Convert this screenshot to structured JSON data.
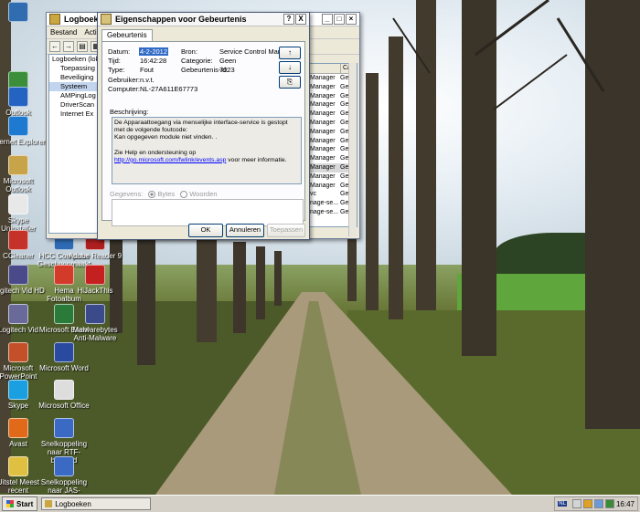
{
  "desktop": {
    "icons": [
      {
        "label": "",
        "color": "#2f6cb0"
      },
      {
        "label": "",
        "color": "#3b8f3b"
      },
      {
        "label": "Outlook",
        "color": "#2463c2"
      },
      {
        "label": "Internet Explorer",
        "color": "#1e7ad0"
      },
      {
        "label": "Microsoft Outlook",
        "color": "#c7a34a"
      },
      {
        "label": "Skype Uninstaller",
        "color": "#e8e8e8"
      },
      {
        "label": "CCleaner",
        "color": "#c4322a"
      },
      {
        "label": "HCC Computer Geschoonmaakt",
        "color": "#2e6bb4"
      },
      {
        "label": "Adobe Reader 9",
        "color": "#b01f1f"
      },
      {
        "label": "Logitech Vid HD",
        "color": "#4a4a8a"
      },
      {
        "label": "Hema Fotoalbum",
        "color": "#d23a2a"
      },
      {
        "label": "HiJackThis",
        "color": "#c42020"
      },
      {
        "label": "Logitech Vid",
        "color": "#6a6a9a"
      },
      {
        "label": "Microsoft Excel",
        "color": "#2a7a3a"
      },
      {
        "label": "Malwarebytes Anti-Malware",
        "color": "#3a4a8a"
      },
      {
        "label": "Microsoft PowerPoint",
        "color": "#c4502a"
      },
      {
        "label": "Microsoft Word",
        "color": "#2a4aa0"
      },
      {
        "label": "Skype",
        "color": "#1aa0e0"
      },
      {
        "label": "Microsoft Office",
        "color": "#dddddd"
      },
      {
        "label": "Avast",
        "color": "#e06a1a"
      },
      {
        "label": "Snelkoppeling naar RTF-bestand",
        "color": "#3a6ac4"
      },
      {
        "label": "Snelkoppeling naar JAS-bestand",
        "color": "#3a6ac4"
      },
      {
        "label": "Uitstel Meest recent",
        "color": "#e0c040"
      }
    ]
  },
  "logwindow": {
    "title": "Logboeken",
    "menu": [
      "Bestand",
      "Actie"
    ],
    "tree": [
      {
        "label": "Logboeken (lok",
        "selected": false
      },
      {
        "label": "Toepassing",
        "selected": false
      },
      {
        "label": "Beveiliging",
        "selected": false
      },
      {
        "label": "Systeem",
        "selected": true
      },
      {
        "label": "AMPingLog",
        "selected": false
      },
      {
        "label": "DriverScan",
        "selected": false
      },
      {
        "label": "Internet Ex",
        "selected": false
      }
    ],
    "list_header": [
      "",
      "Ca"
    ],
    "list_rows": [
      {
        "src": "Manager",
        "cat": "Ge",
        "hl": false
      },
      {
        "src": "Manager",
        "cat": "Ge",
        "hl": false
      },
      {
        "src": "Manager",
        "cat": "Ge",
        "hl": false
      },
      {
        "src": "Manager",
        "cat": "Ge",
        "hl": false
      },
      {
        "src": "Manager",
        "cat": "Ge",
        "hl": false
      },
      {
        "src": "Manager",
        "cat": "Ge",
        "hl": false
      },
      {
        "src": "Manager",
        "cat": "Ge",
        "hl": false
      },
      {
        "src": "Manager",
        "cat": "Ge",
        "hl": false
      },
      {
        "src": "Manager",
        "cat": "Ge",
        "hl": false
      },
      {
        "src": "Manager",
        "cat": "Ge",
        "hl": false
      },
      {
        "src": "Manager",
        "cat": "Ge",
        "hl": true
      },
      {
        "src": "Manager",
        "cat": "Ge",
        "hl": false
      },
      {
        "src": "Manager",
        "cat": "Ge",
        "hl": false
      },
      {
        "src": "vc",
        "cat": "Ge",
        "hl": false
      },
      {
        "src": "nage-se...",
        "cat": "Ge",
        "hl": false
      },
      {
        "src": "nage-se...",
        "cat": "Ge",
        "hl": false
      }
    ]
  },
  "dialog": {
    "title": "Eigenschappen voor Gebeurtenis",
    "help_btn": "?",
    "close_btn": "X",
    "tab": "Gebeurtenis",
    "fields": {
      "datum_label": "Datum:",
      "datum": "4-2-2012",
      "tijd_label": "Tijd:",
      "tijd": "16:42:28",
      "type_label": "Type:",
      "type": "Fout",
      "gebruiker_label": "Gebruiker:",
      "gebruiker": "n.v.t.",
      "computer_label": "Computer:",
      "computer": "NL-27A611E67773",
      "bron_label": "Bron:",
      "bron": "Service Control Manager",
      "categorie_label": "Categorie:",
      "categorie": "Geen",
      "id_label": "Gebeurtenis-id:",
      "id": "7023"
    },
    "beschrijving_label": "Beschrijving:",
    "description_line1": "De Apparaattoegang via menselijke interface-service is gestopt met de volgende foutcode:",
    "description_line2": "Kan opgegeven module niet vinden. .",
    "help_prefix": "Zie Help en ondersteuning op ",
    "help_link": "http://go.microsoft.com/fwlink/events.asp",
    "help_suffix": " voor meer informatie.",
    "gegevens_label": "Gegevens:",
    "bytes_label": "Bytes",
    "woorden_label": "Woorden",
    "ok": "OK",
    "annuleren": "Annuleren",
    "toepassen": "Toepassen"
  },
  "taskbar": {
    "start": "Start",
    "task": "Logboeken",
    "lang": "NL",
    "clock": "16:47"
  }
}
